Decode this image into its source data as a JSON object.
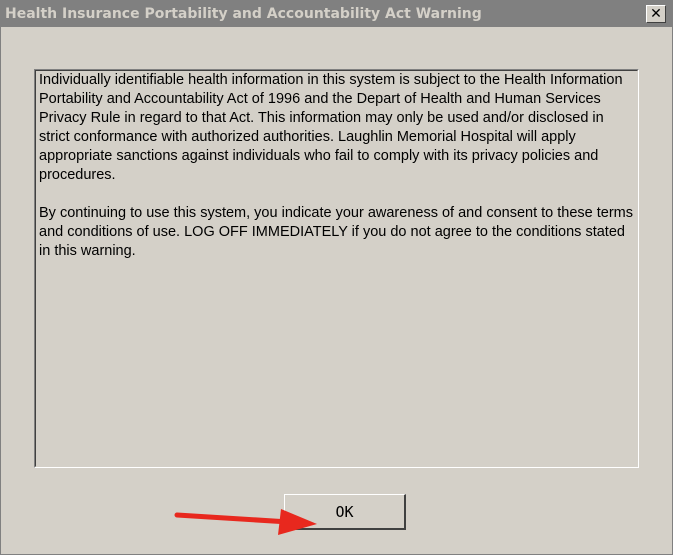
{
  "window": {
    "title": "Health Insurance Portability and Accountability Act Warning",
    "close_glyph": "✕"
  },
  "message": {
    "paragraphs": [
      "Individually identifiable health information in this system is subject to the Health Information Portability and Accountability Act of 1996 and the Depart of Health and Human Services Privacy Rule in regard to that Act. This information may only be used and/or disclosed in strict conformance with authorized authorities. Laughlin Memorial Hospital will apply appropriate sanctions against individuals who fail to comply with its privacy policies and procedures.",
      "By continuing to use this system, you indicate your awareness of and consent to these terms and conditions of use. LOG OFF IMMEDIATELY if you do not agree to the conditions stated in this warning."
    ]
  },
  "buttons": {
    "ok_label": "OK"
  },
  "annotation": {
    "arrow_icon": "red-arrow-icon",
    "arrow_color": "#e8281e"
  },
  "colors": {
    "dialog_bg": "#d4d0c8",
    "titlebar_bg": "#808080"
  }
}
